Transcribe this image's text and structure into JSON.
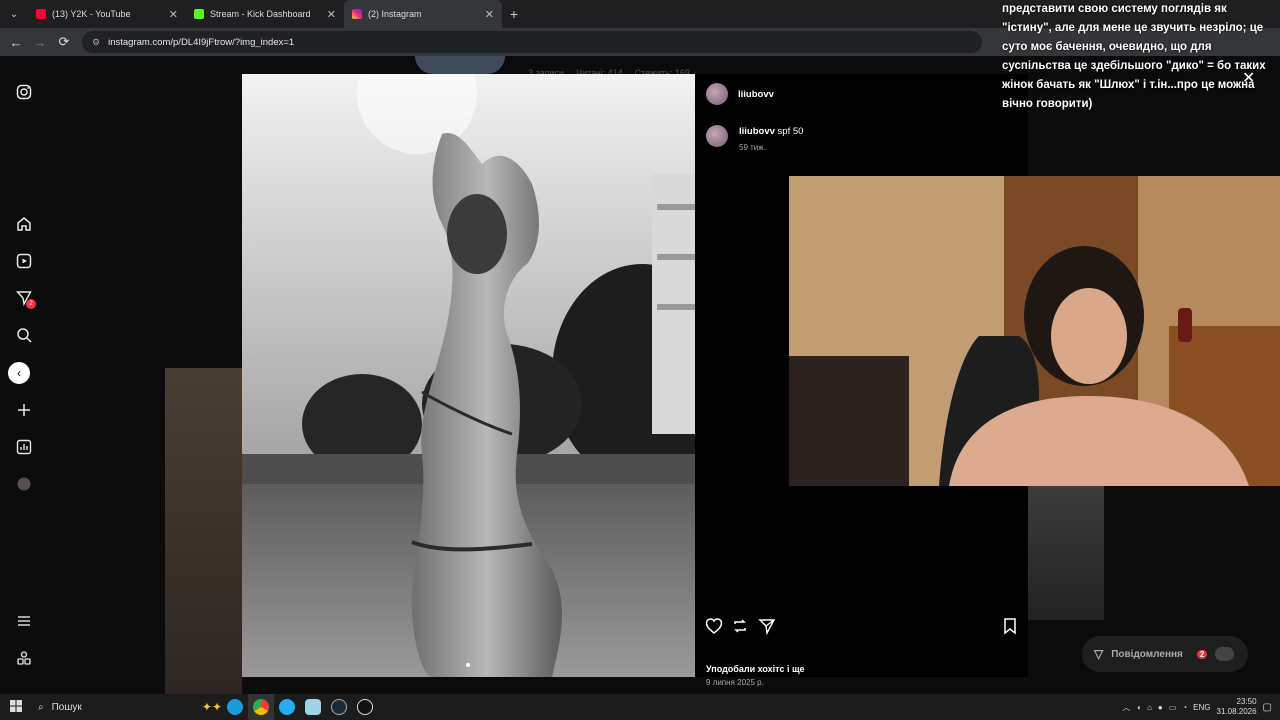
{
  "browser": {
    "tabs": [
      {
        "label": "(13) Y2K - YouTube",
        "favicon_color": "#ff0033"
      },
      {
        "label": "Stream - Kick Dashboard",
        "favicon_color": "#53fc18"
      },
      {
        "label": "(2) Instagram",
        "favicon_color": "#e1306c"
      }
    ],
    "url": "instagram.com/p/DL4I9jFtrow/?img_index=1"
  },
  "sidebar": {
    "notifications_badge": "2"
  },
  "backdrop_stats": [
    "3 записи",
    "Читачі: 414",
    "Стежить: 169"
  ],
  "post": {
    "author": "liiubovv",
    "caption_author": "liiubovv",
    "caption_text": "spf 50",
    "time_ago": "59 тиж.",
    "likes_text": "Уподобали хохітс і ще",
    "date": "9 липня 2025 р."
  },
  "messages_button": {
    "label": "Повідомлення",
    "badge": "2"
  },
  "overlay_text": "представити свою систему поглядів як \"істину\", але для мене це звучить незріло; це суто моє бачення, очевидно, що для суспільства це здебільшого \"дико\" = бо таких жінок бачать як \"Шлюх\" і т.ін...про це можна вічно говорити)",
  "taskbar": {
    "search_label": "Пошук",
    "language": "ENG",
    "time": "23:50",
    "date": "31.08.2026"
  }
}
